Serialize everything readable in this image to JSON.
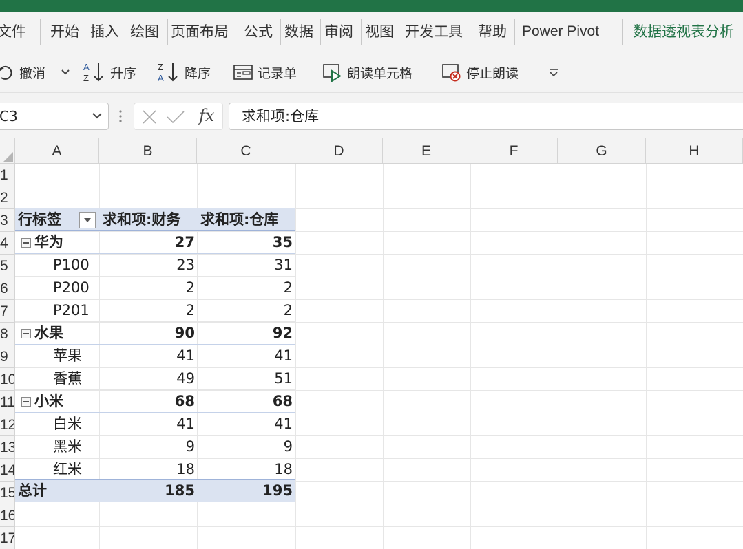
{
  "ribbon": {
    "tabs": [
      "文件",
      "开始",
      "插入",
      "绘图",
      "页面布局",
      "公式",
      "数据",
      "审阅",
      "视图",
      "开发工具",
      "帮助",
      "Power Pivot",
      "数据透视表分析"
    ],
    "active_tab": "数据透视表分析"
  },
  "toolbar": {
    "undo": "撤消",
    "sort_asc": "升序",
    "sort_desc": "降序",
    "form": "记录单",
    "speak_cells": "朗读单元格",
    "stop_speaking": "停止朗读"
  },
  "formula_bar": {
    "name_box": "C3",
    "formula": "求和项:仓库"
  },
  "grid": {
    "columns": [
      "A",
      "B",
      "C",
      "D",
      "E",
      "F",
      "G",
      "H"
    ],
    "row_numbers": [
      "1",
      "2",
      "3",
      "4",
      "5",
      "6",
      "7",
      "8",
      "9",
      "10",
      "11",
      "12",
      "13",
      "14",
      "15",
      "16",
      "17"
    ]
  },
  "pivot": {
    "header": [
      "行标签",
      "求和项:财务",
      "求和项:仓库"
    ],
    "groups": [
      {
        "name": "华为",
        "b": "27",
        "c": "35",
        "items": [
          {
            "name": "P100",
            "b": "23",
            "c": "31"
          },
          {
            "name": "P200",
            "b": "2",
            "c": "2"
          },
          {
            "name": "P201",
            "b": "2",
            "c": "2"
          }
        ]
      },
      {
        "name": "水果",
        "b": "90",
        "c": "92",
        "items": [
          {
            "name": "苹果",
            "b": "41",
            "c": "41"
          },
          {
            "name": "香蕉",
            "b": "49",
            "c": "51"
          }
        ]
      },
      {
        "name": "小米",
        "b": "68",
        "c": "68",
        "items": [
          {
            "name": "白米",
            "b": "41",
            "c": "41"
          },
          {
            "name": "黑米",
            "b": "9",
            "c": "9"
          },
          {
            "name": "红米",
            "b": "18",
            "c": "18"
          }
        ]
      }
    ],
    "total": {
      "label": "总计",
      "b": "185",
      "c": "195"
    }
  },
  "colors": {
    "accent": "#217346",
    "pivot_header": "#dbe3f1"
  }
}
